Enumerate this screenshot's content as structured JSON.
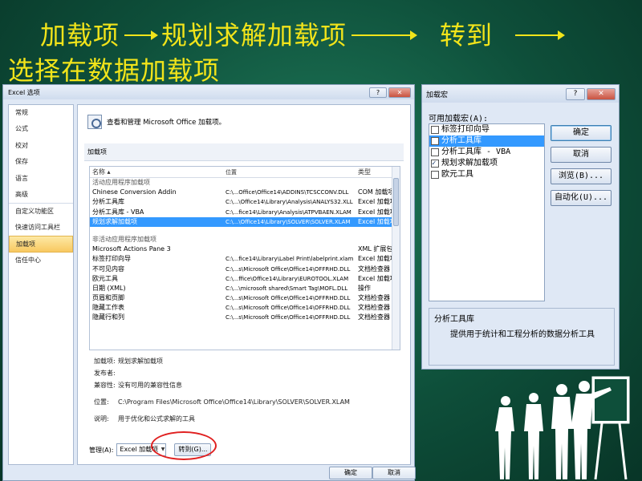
{
  "slide": {
    "title_line1": [
      "加载项",
      "规划求解加载项",
      "转到"
    ],
    "title_line2": "选择在数据加载项"
  },
  "options_window": {
    "title": "Excel 选项",
    "titlebar_buttons": [
      "?",
      "✕"
    ],
    "nav": [
      "常规",
      "公式",
      "校对",
      "保存",
      "语言",
      "高级",
      "自定义功能区",
      "快速访问工具栏",
      "加载项",
      "信任中心"
    ],
    "active_nav": "加载项",
    "header": "查看和管理 Microsoft Office 加载项。",
    "section": "加载项",
    "columns": [
      "名称 ▴",
      "位置",
      "类型"
    ],
    "group_active": "活动应用程序加载项",
    "active_rows": [
      {
        "name": "Chinese Conversion Addin",
        "loc": "C:\\...Office\\Office14\\ADDINS\\TCSCCONV.DLL",
        "type": "COM 加载项"
      },
      {
        "name": "分析工具库",
        "loc": "C:\\...\\Office14\\Library\\Analysis\\ANALYS32.XLL",
        "type": "Excel 加载项"
      },
      {
        "name": "分析工具库 - VBA",
        "loc": "C:\\...fice14\\Library\\Analysis\\ATPVBAEN.XLAM",
        "type": "Excel 加载项"
      },
      {
        "name": "规划求解加载项",
        "loc": "C:\\...\\Office14\\Library\\SOLVER\\SOLVER.XLAM",
        "type": "Excel 加载项"
      }
    ],
    "group_inactive": "非活动应用程序加载项",
    "inactive_rows": [
      {
        "name": "Microsoft Actions Pane 3",
        "loc": "",
        "type": "XML 扩展包"
      },
      {
        "name": "标签打印向导",
        "loc": "C:\\...fice14\\Library\\Label Print\\labelprint.xlam",
        "type": "Excel 加载项"
      },
      {
        "name": "不可见内容",
        "loc": "C:\\...s\\Microsoft Office\\Office14\\OFFRHD.DLL",
        "type": "文档检查器"
      },
      {
        "name": "欧元工具",
        "loc": "C:\\...ffice\\Office14\\Library\\EUROTOOL.XLAM",
        "type": "Excel 加载项"
      },
      {
        "name": "日期 (XML)",
        "loc": "C:\\...\\microsoft shared\\Smart Tag\\MOFL.DLL",
        "type": "操作"
      },
      {
        "name": "页眉和页脚",
        "loc": "C:\\...s\\Microsoft Office\\Office14\\OFFRHD.DLL",
        "type": "文档检查器"
      },
      {
        "name": "隐藏工作表",
        "loc": "C:\\...s\\Microsoft Office\\Office14\\OFFRHD.DLL",
        "type": "文档检查器"
      },
      {
        "name": "隐藏行和列",
        "loc": "C:\\...s\\Microsoft Office\\Office14\\OFFRHD.DLL",
        "type": "文档检查器"
      }
    ],
    "details": {
      "addin_label": "加载项:",
      "addin_value": "规划求解加载项",
      "publisher_label": "发布者:",
      "publisher_value": "",
      "compat_label": "兼容性:",
      "compat_value": "没有可用的兼容性信息",
      "location_label": "位置:",
      "location_value": "C:\\Program Files\\Microsoft Office\\Office14\\Library\\SOLVER\\SOLVER.XLAM",
      "desc_label": "说明:",
      "desc_value": "用于优化和公式求解的工具"
    },
    "manage_label": "管理(A):",
    "manage_value": "Excel 加载项",
    "goto_label": "转到(G)...",
    "ok_label": "确定",
    "cancel_label": "取消"
  },
  "addins_dialog": {
    "title": "加载宏",
    "titlebar_buttons": [
      "?",
      "✕"
    ],
    "list_label": "可用加载宏(A):",
    "items": [
      {
        "label": "标签打印向导",
        "checked": false,
        "selected": false
      },
      {
        "label": "分析工具库",
        "checked": false,
        "selected": true
      },
      {
        "label": "分析工具库 - VBA",
        "checked": false,
        "selected": false
      },
      {
        "label": "规划求解加载项",
        "checked": true,
        "selected": false
      },
      {
        "label": "欧元工具",
        "checked": false,
        "selected": false
      }
    ],
    "buttons": [
      "确定",
      "取消",
      "浏览(B)...",
      "自动化(U)..."
    ],
    "desc_title": "分析工具库",
    "desc_text": "提供用于统计和工程分析的数据分析工具"
  },
  "colors": {
    "title": "#f2e41a",
    "highlight": "#e02020",
    "selection": "#3399ff"
  }
}
